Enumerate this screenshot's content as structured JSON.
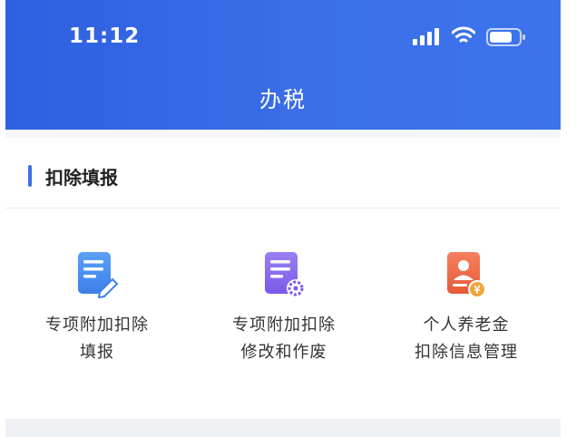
{
  "status_bar": {
    "time": "11:12"
  },
  "header": {
    "title": "办税"
  },
  "section": {
    "title": "扣除填报"
  },
  "items": [
    {
      "line1": "专项附加扣除",
      "line2": "填报",
      "icon": "document-edit-icon",
      "color": "#4c8ff0"
    },
    {
      "line1": "专项附加扣除",
      "line2": "修改和作废",
      "icon": "document-settings-icon",
      "color": "#8b6cf0"
    },
    {
      "line1": "个人养老金",
      "line2": "扣除信息管理",
      "icon": "pension-card-icon",
      "color": "#ef6a4b"
    }
  ],
  "colors": {
    "header": "#3a6fe8",
    "accent": "#3a6ee8"
  }
}
